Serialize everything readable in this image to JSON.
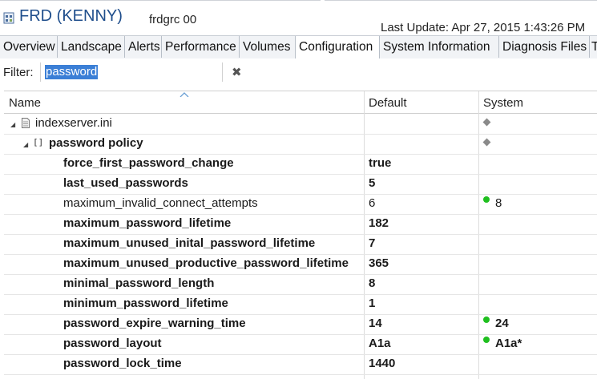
{
  "window": {
    "system_title": "FRD (KENNY)",
    "host": "frdgrc 00",
    "last_update": "Last Update:  Apr 27, 2015 1:43:26 PM"
  },
  "tabs": [
    {
      "label": "Overview",
      "active": false
    },
    {
      "label": "Landscape",
      "active": false
    },
    {
      "label": "Alerts",
      "active": false
    },
    {
      "label": "Performance",
      "active": false
    },
    {
      "label": "Volumes",
      "active": false
    },
    {
      "label": "Configuration",
      "active": true
    },
    {
      "label": "System Information",
      "active": false
    },
    {
      "label": "Diagnosis Files",
      "active": false
    },
    {
      "label": "T",
      "active": false
    }
  ],
  "filter": {
    "label": "Filter:",
    "value": "password"
  },
  "table": {
    "columns": [
      "Name",
      "Default",
      "System"
    ],
    "rows": [
      {
        "name": "indexserver.ini",
        "default": "",
        "system": "",
        "level": 0,
        "bold": false
      },
      {
        "name": "password policy",
        "default": "",
        "system": "",
        "level": 1,
        "bold": true
      },
      {
        "name": "force_first_password_change",
        "default": "true",
        "system": "",
        "level": 2,
        "bold": true
      },
      {
        "name": "last_used_passwords",
        "default": "5",
        "system": "",
        "level": 2,
        "bold": true
      },
      {
        "name": "maximum_invalid_connect_attempts",
        "default": "6",
        "system": "8",
        "level": 2,
        "bold": false
      },
      {
        "name": "maximum_password_lifetime",
        "default": "182",
        "system": "",
        "level": 2,
        "bold": true
      },
      {
        "name": "maximum_unused_inital_password_lifetime",
        "default": "7",
        "system": "",
        "level": 2,
        "bold": true
      },
      {
        "name": "maximum_unused_productive_password_lifetime",
        "default": "365",
        "system": "",
        "level": 2,
        "bold": true
      },
      {
        "name": "minimal_password_length",
        "default": "8",
        "system": "",
        "level": 2,
        "bold": true
      },
      {
        "name": "minimum_password_lifetime",
        "default": "1",
        "system": "",
        "level": 2,
        "bold": true
      },
      {
        "name": "password_expire_warning_time",
        "default": "14",
        "system": "24",
        "level": 2,
        "bold": true
      },
      {
        "name": "password_layout",
        "default": "A1a",
        "system": "A1a*",
        "level": 2,
        "bold": true
      },
      {
        "name": "password_lock_time",
        "default": "1440",
        "system": "",
        "level": 2,
        "bold": true
      }
    ]
  },
  "colors": {
    "title": "#1f4e8c",
    "selection": "#3b7fd6",
    "changed_dot": "#1fbf1f"
  }
}
